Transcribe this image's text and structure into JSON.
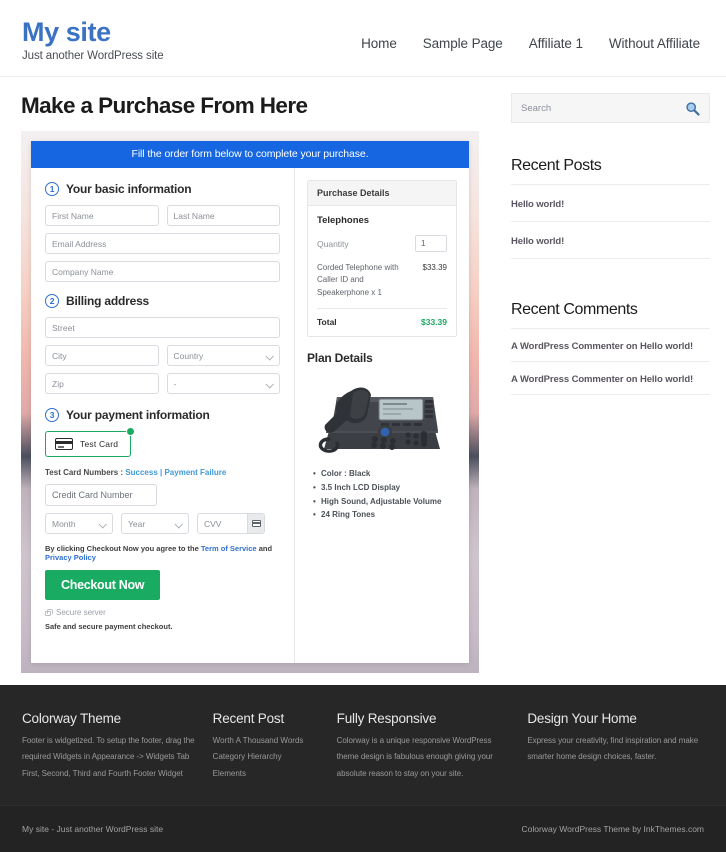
{
  "header": {
    "site_title": "My site",
    "tagline": "Just another WordPress site",
    "nav": [
      {
        "label": "Home"
      },
      {
        "label": "Sample Page"
      },
      {
        "label": "Affiliate 1"
      },
      {
        "label": "Without Affiliate"
      }
    ]
  },
  "main": {
    "page_title": "Make a Purchase From Here",
    "banner": "Fill the order form below to complete your purchase.",
    "steps": {
      "step1_num": "1",
      "step1_label": "Your basic information",
      "step2_num": "2",
      "step2_label": "Billing address",
      "step3_num": "3",
      "step3_label": "Your payment information"
    },
    "fields": {
      "first_name": "First Name",
      "last_name": "Last Name",
      "email": "Email Address",
      "company": "Company Name",
      "street": "Street",
      "city": "City",
      "country": "Country",
      "zip": "Zip",
      "state": "-",
      "credit_card": "Credit Card Number",
      "month": "Month",
      "year": "Year",
      "cvv": "CVV"
    },
    "payment": {
      "card_tile_label": "Test  Card",
      "test_numbers_prefix": "Test Card Numbers : ",
      "test_success": "Success",
      "test_separator": " | ",
      "test_failure": "Payment Failure",
      "terms_prefix": "By clicking Checkout Now you agree to the ",
      "terms_tos": "Term of Service",
      "terms_and": " and ",
      "terms_privacy": "Privacy Policy",
      "checkout_button": "Checkout Now",
      "secure_server": "Secure server",
      "safe_note": "Safe and secure payment checkout."
    },
    "purchase_details": {
      "title": "Purchase Details",
      "product": "Telephones",
      "quantity_label": "Quantity",
      "quantity_value": "1",
      "line_item": "Corded Telephone with Caller ID and Speakerphone x 1",
      "line_price": "$33.39",
      "total_label": "Total",
      "total_value": "$33.39"
    },
    "plan": {
      "title": "Plan Details",
      "features": [
        "Color : Black",
        "3.5 Inch LCD Display",
        "High Sound, Adjustable Volume",
        "24 Ring Tones"
      ]
    }
  },
  "sidebar": {
    "search_placeholder": "Search",
    "recent_posts_title": "Recent Posts",
    "recent_posts": [
      {
        "label": "Hello world!"
      },
      {
        "label": "Hello world!"
      }
    ],
    "recent_comments_title": "Recent Comments",
    "recent_comments": [
      {
        "label": "A WordPress Commenter on Hello world!"
      },
      {
        "label": "A WordPress Commenter on Hello world!"
      }
    ]
  },
  "footer": {
    "widgets": [
      {
        "title": "Colorway Theme",
        "text": "Footer is widgetized. To setup the footer, drag the required Widgets in Appearance -> Widgets Tab First, Second, Third and Fourth Footer Widget"
      },
      {
        "title": "Recent Post",
        "links": [
          {
            "label": "Worth A Thousand Words"
          },
          {
            "label": "Category Hierarchy"
          },
          {
            "label": "Elements"
          }
        ]
      },
      {
        "title": "Fully Responsive",
        "text": "Colorway is a unique responsive WordPress theme design is fabulous enough giving your absolute reason to stay on your site."
      },
      {
        "title": "Design Your Home",
        "text": "Express your creativity, find inspiration and make smarter home design choices, faster."
      }
    ],
    "copyright": "My site - Just another WordPress site",
    "credit": "Colorway WordPress Theme by InkThemes.com"
  },
  "colors": {
    "brand_blue": "#3b72c4",
    "banner_blue": "#1566e0",
    "green": "#1aab62",
    "link_blue": "#2f6fd0",
    "footer_dark": "#272727"
  }
}
